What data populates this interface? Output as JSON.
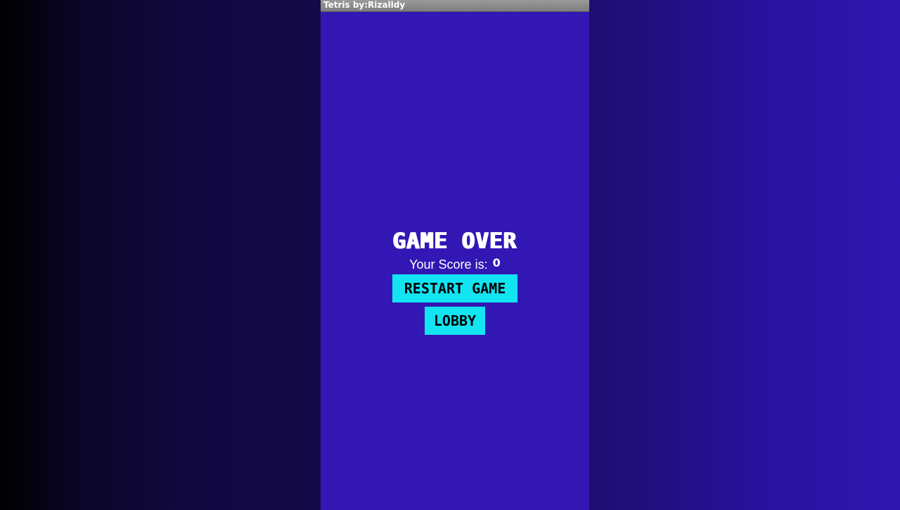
{
  "window": {
    "title": "Tetris by:Rizalldy"
  },
  "game_over": {
    "heading": "GAME OVER",
    "score_label": "Your Score is:",
    "score_value": "0",
    "restart_label": "RESTART GAME",
    "lobby_label": "LOBBY"
  },
  "colors": {
    "background": "#3317b4",
    "button": "#12e4f2",
    "titlebar": "#8c8c8c"
  }
}
